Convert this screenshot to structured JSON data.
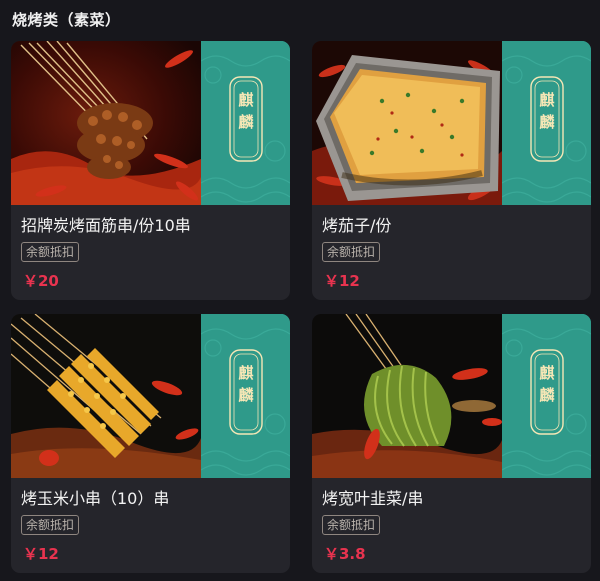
{
  "section": {
    "title": "烧烤类（素菜）"
  },
  "brand": {
    "text": "麒\n麟",
    "color": "#2f9a8a"
  },
  "accent": {
    "price_color": "#e8334f"
  },
  "products": [
    {
      "name": "招牌炭烤面筋串/份10串",
      "tag": "余额抵扣",
      "price": "￥20",
      "image": "grilled-gluten-skewers-photo"
    },
    {
      "name": "烤茄子/份",
      "tag": "余额抵扣",
      "price": "￥12",
      "image": "grilled-eggplant-photo"
    },
    {
      "name": "烤玉米小串（10）串",
      "tag": "余额抵扣",
      "price": "￥12",
      "image": "corn-skewers-photo"
    },
    {
      "name": "烤宽叶韭菜/串",
      "tag": "余额抵扣",
      "price": "￥3.8",
      "image": "chive-skewers-photo"
    }
  ]
}
